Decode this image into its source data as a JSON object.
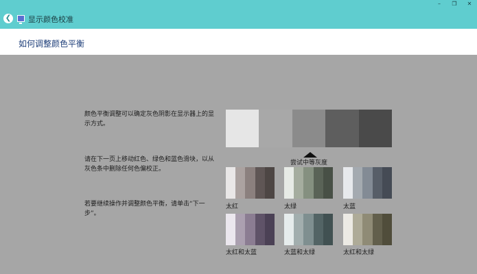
{
  "window": {
    "title": "显示颜色校准",
    "back_icon": "arrow-left-icon",
    "controls": [
      "–",
      "❐",
      "✕"
    ]
  },
  "header": {
    "title": "如何调整颜色平衡"
  },
  "description": {
    "p1": "颜色平衡调整可以确定灰色阴影在显示器上的显示方式。",
    "p2": "请在下一页上移动红色、绿色和蓝色滑块，以从灰色条中删除任何色偏校正。",
    "p3": "若要继续操作并调整颜色平衡，请单击“下一步”。"
  },
  "gradient": {
    "label": "尝试中等灰度",
    "colors": [
      "#e6e6e6",
      "#a8a8a8",
      "#8b8b8b",
      "#5e5e5e",
      "#4a4a4a"
    ]
  },
  "samples": [
    {
      "label": "太红",
      "colors": [
        "#e9e7e7",
        "#aba2a0",
        "#8b807e",
        "#5f5655",
        "#4d4644"
      ]
    },
    {
      "label": "太绿",
      "colors": [
        "#e7ebe6",
        "#a5ad9f",
        "#859080",
        "#5a6357",
        "#485046"
      ]
    },
    {
      "label": "太蓝",
      "colors": [
        "#e7e9ec",
        "#a4aab0",
        "#838b95",
        "#575e68",
        "#454b55"
      ]
    },
    {
      "label": "太红和太蓝",
      "colors": [
        "#ebe7ee",
        "#aba0b0",
        "#8b7d92",
        "#5f5368",
        "#4b4155"
      ]
    },
    {
      "label": "太蓝和太绿",
      "colors": [
        "#e6ecec",
        "#a2aeae",
        "#7f8f90",
        "#536465",
        "#415152"
      ]
    },
    {
      "label": "太红和太绿",
      "colors": [
        "#eceae4",
        "#aeab98",
        "#8f8b76",
        "#625f4c",
        "#504d3b"
      ]
    }
  ]
}
